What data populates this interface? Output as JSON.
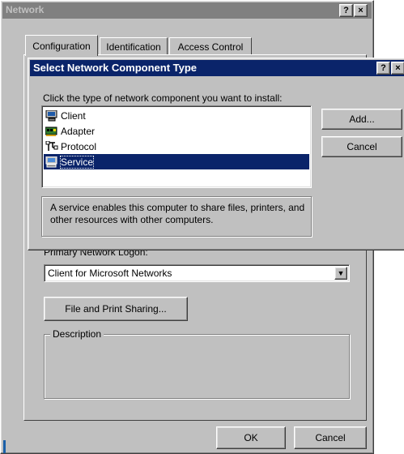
{
  "network_window": {
    "title": "Network",
    "help_btn": "?",
    "close_btn": "×",
    "tabs": [
      {
        "label": "Configuration"
      },
      {
        "label": "Identification"
      },
      {
        "label": "Access Control"
      }
    ],
    "primary_logon_label": "Primary Network Logon:",
    "primary_logon_value": "Client for Microsoft Networks",
    "file_print_button": "File and Print Sharing...",
    "description_label": "Description",
    "ok_button": "OK",
    "cancel_button": "Cancel"
  },
  "select_dialog": {
    "title": "Select Network Component Type",
    "help_btn": "?",
    "close_btn": "×",
    "instruction": "Click the type of network component you want to install:",
    "items": [
      {
        "label": "Client",
        "icon": "client-icon"
      },
      {
        "label": "Adapter",
        "icon": "adapter-icon"
      },
      {
        "label": "Protocol",
        "icon": "protocol-icon"
      },
      {
        "label": "Service",
        "icon": "service-icon"
      }
    ],
    "selected_item": "Service",
    "add_button": "Add...",
    "cancel_button": "Cancel",
    "description": "A service enables this computer to share files, printers, and other resources with other computers."
  },
  "colors": {
    "face": "#c0c0c0",
    "title_active": "#0a246a",
    "title_inactive": "#808080",
    "selection": "#0a246a"
  }
}
